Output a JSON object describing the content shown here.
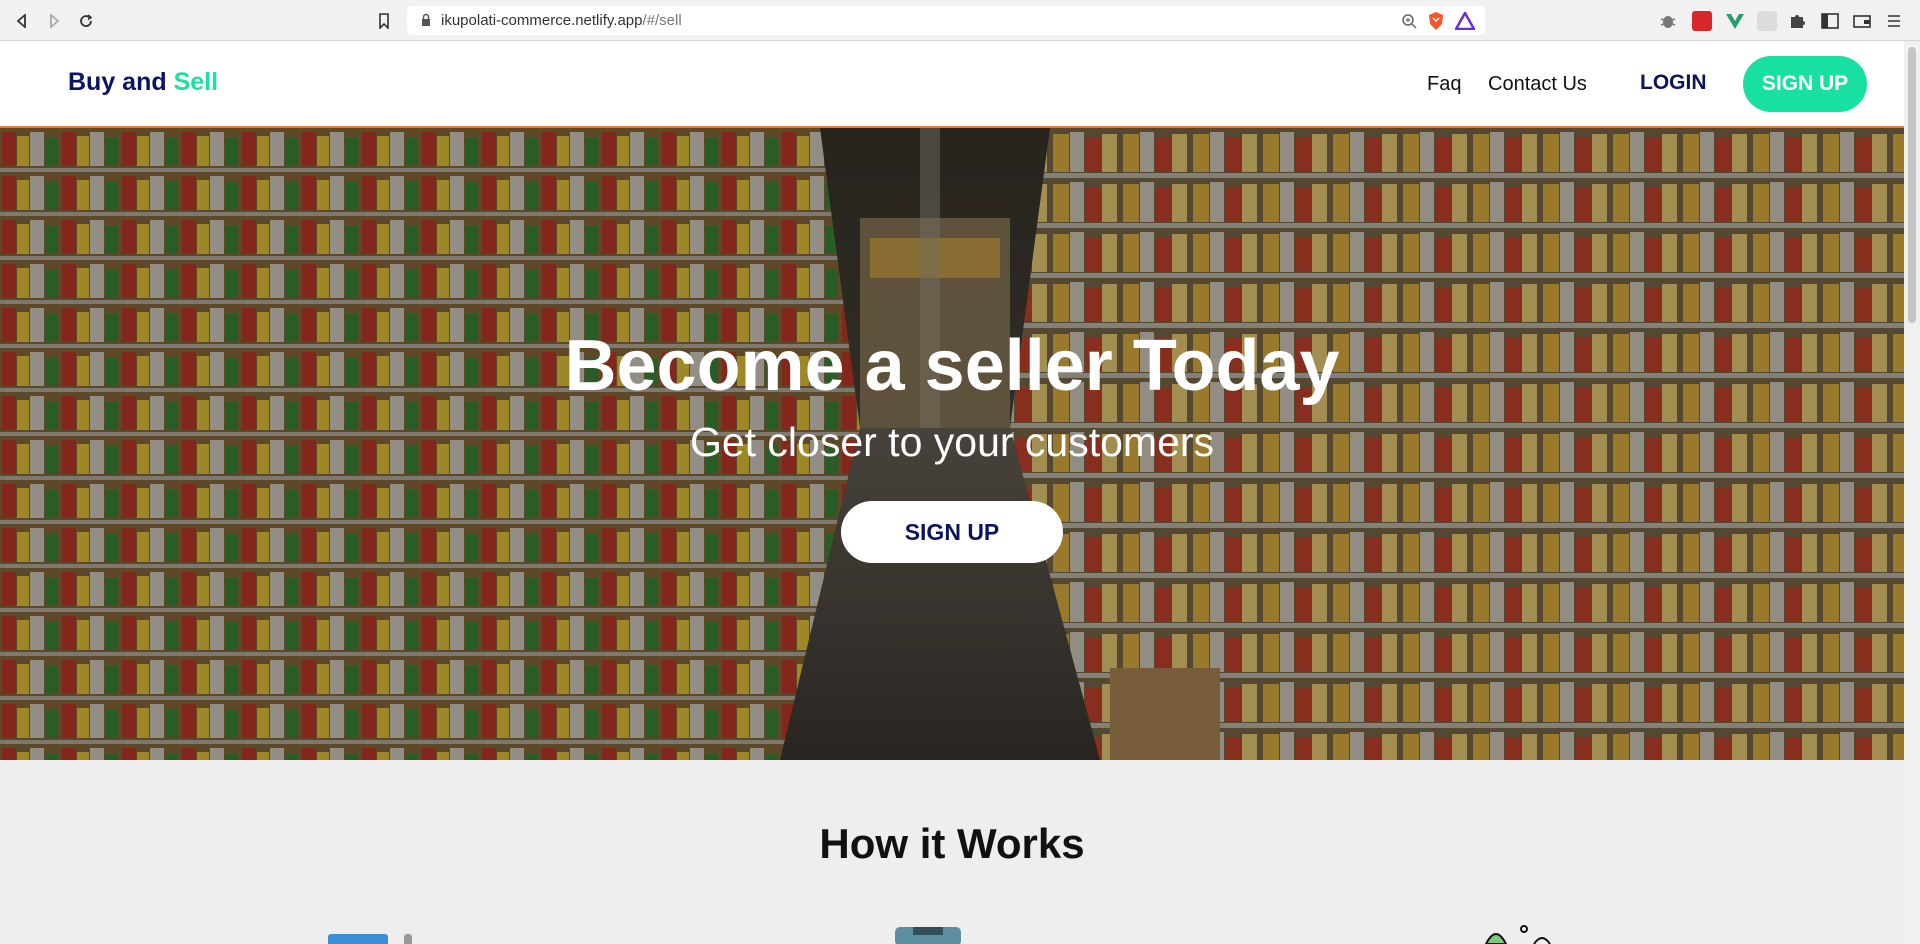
{
  "browser": {
    "url_host": "ikupolati-commerce.netlify.app",
    "url_path": "/#/sell"
  },
  "navbar": {
    "brand_part1": "Buy and",
    "brand_part2": "Sell",
    "faq_label": "Faq",
    "contact_label": "Contact Us",
    "login_label": "LOGIN",
    "signup_label": "SIGN UP",
    "accent_color": "#1de0a5",
    "brand_color": "#0b1460"
  },
  "hero": {
    "title": "Become a seller Today",
    "subtitle": "Get closer to your customers",
    "cta_label": "SIGN UP"
  },
  "how_it_works": {
    "title": "How it Works"
  }
}
